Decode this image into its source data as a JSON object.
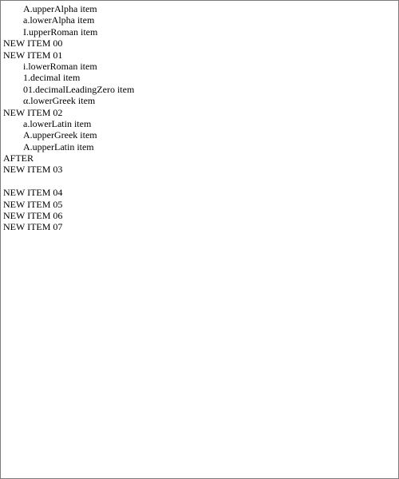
{
  "items": {
    "upper_alpha": "A.upperAlpha item",
    "lower_alpha": "a.lowerAlpha item",
    "upper_roman": "I.upperRoman item",
    "new_item_00": "NEW ITEM 00",
    "new_item_01": "NEW ITEM 01",
    "lower_roman": "i.lowerRoman item",
    "decimal": "1.decimal item",
    "decimal_leading_zero": "01.decimalLeadingZero item",
    "lower_greek": "α.lowerGreek item",
    "new_item_02": "NEW ITEM 02",
    "lower_latin": "a.lowerLatin item",
    "upper_greek": "A.upperGreek item",
    "upper_latin": "A.upperLatin item",
    "after": "AFTER",
    "new_item_03": "NEW ITEM 03",
    "new_item_04": "NEW ITEM 04",
    "new_item_05": "NEW ITEM 05",
    "new_item_06": "NEW ITEM 06",
    "new_item_07": "NEW ITEM 07"
  }
}
